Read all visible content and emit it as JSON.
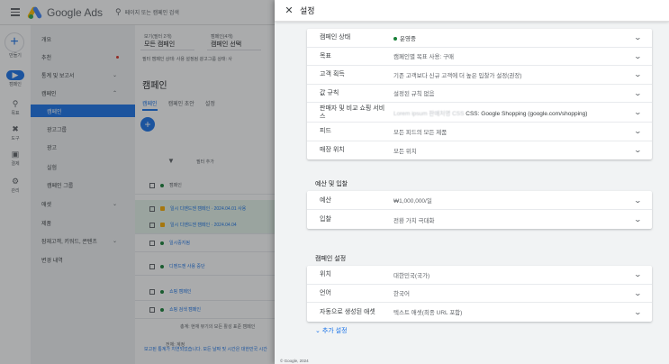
{
  "app": {
    "logo_text": "Google Ads",
    "search_placeholder": "페이지 또는 캠페인 검색"
  },
  "rail": {
    "create_label": "만들기",
    "items": [
      {
        "icon": "campaign-icon",
        "label": "캠페인"
      },
      {
        "icon": "goals-icon",
        "label": "목표"
      },
      {
        "icon": "tools-icon",
        "label": "도구"
      },
      {
        "icon": "billing-icon",
        "label": "결제"
      },
      {
        "icon": "admin-icon",
        "label": "관리"
      }
    ]
  },
  "nav": {
    "items": [
      {
        "label": "개요"
      },
      {
        "label": "추천"
      },
      {
        "label": "통계 및 보고서"
      },
      {
        "label": "캠페인"
      },
      {
        "label": "캠페인"
      },
      {
        "label": "광고그룹"
      },
      {
        "label": "광고"
      },
      {
        "label": "실험"
      },
      {
        "label": "캠페인 그룹"
      },
      {
        "label": "애셋"
      },
      {
        "label": "제품"
      },
      {
        "label": "잠재고객, 키워드, 콘텐츠"
      },
      {
        "label": "변경 내역"
      }
    ]
  },
  "main": {
    "filter1_top": "보기(필터 2개)",
    "filter1_value": "모든 캠페인",
    "filter2_top": "캠페인(4개)",
    "filter2_value": "캠페인 선택",
    "chips": "필터  캠페인 상태: 사용 설정됨   광고그룹 상태: 사",
    "title": "캠페인",
    "tabs": [
      "캠페인",
      "캠페인 초안",
      "설정"
    ],
    "filter_add": "필터 추가",
    "col_campaign": "캠페인",
    "rows": [
      "일시 디멘드젠 캠페인 · 2024.04.01 사용",
      "일시 디멘드젠 캠페인 · 2024.04.04",
      "일시중지됨",
      "디멘드젠 사용 중단",
      "쇼핑 캠페인",
      "쇼핑 검색 캠페인"
    ],
    "total_row": "총계: 현재 뷰기의 모든 활성 표준 캠페인",
    "total_row2": "전체: 계정",
    "footnote": "보고된 통계가 지연되었습니다. 모든 날짜 및 시간은 대한민국 시간"
  },
  "panel": {
    "title": "설정",
    "card1": [
      {
        "label": "캠페인 상태",
        "value": "운영중",
        "status_color": "#188038"
      },
      {
        "label": "목표",
        "value": "캠페인별 목표 사용: 구매"
      },
      {
        "label": "고객 획득",
        "value": "기존 고객보다 신규 고객에 더 높은 입찰가 설정(권장)"
      },
      {
        "label": "값 규칙",
        "value": "설정된 규칙 없음"
      },
      {
        "label": "판매자 및 비교 쇼핑 서비스",
        "value_blur": "Lorem ipsum 판매처명 CSS",
        "value": "CSS: Google Shopping (google.com/shopping)"
      },
      {
        "label": "피드",
        "value": "모든 피드의 모든 제품"
      },
      {
        "label": "매장 위치",
        "value": "모든 위치"
      }
    ],
    "budget_section_title": "예산 및 입찰",
    "card2": [
      {
        "label": "예산",
        "value": "₩1,000,000/일"
      },
      {
        "label": "입찰",
        "value": "전환 가치 극대화"
      }
    ],
    "campaign_section_title": "캠페인 설정",
    "card3": [
      {
        "label": "위치",
        "value": "대한민국(국가)"
      },
      {
        "label": "언어",
        "value": "한국어"
      },
      {
        "label": "자동으로 생성된 애셋",
        "value": "텍스트 애셋(최종 URL 포함)"
      }
    ],
    "more_settings": "추가 설정"
  },
  "copyright": "© Google, 2024"
}
